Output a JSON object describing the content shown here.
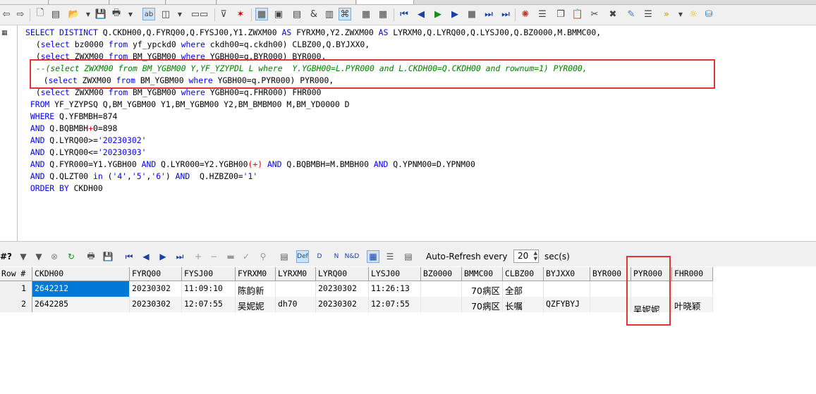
{
  "editor": {
    "lines": [
      [
        [
          "kw",
          "SELECT DISTINCT "
        ],
        [
          "t",
          "Q.CKDH00,Q.FYRQ00,Q.FYSJ00,Y1.ZWXM00 "
        ],
        [
          "kw",
          "AS "
        ],
        [
          "t",
          "FYRXM0,Y2.ZWXM00 "
        ],
        [
          "kw",
          "AS "
        ],
        [
          "t",
          "LYRXM0,Q.LYRQ00,Q.LYSJ00,Q.BZ0000,M.BMMC00,"
        ]
      ],
      [
        [
          "t",
          " ("
        ],
        [
          "kw",
          "select "
        ],
        [
          "t",
          "bz0000 "
        ],
        [
          "kw",
          "from "
        ],
        [
          "t",
          "yf_ypckd0 "
        ],
        [
          "kw",
          "where "
        ],
        [
          "t",
          "ckdh00=q.ckdh00) CLBZ00,Q.BYJXX0,"
        ]
      ],
      [
        [
          "t",
          " ("
        ],
        [
          "kw",
          "select "
        ],
        [
          "t",
          "ZWXM00 "
        ],
        [
          "kw",
          "from "
        ],
        [
          "t",
          "BM_YGBM00 "
        ],
        [
          "kw",
          "where "
        ],
        [
          "t",
          "YGBH00=q.BYR000) BYR000,"
        ]
      ],
      [
        [
          "cm",
          " --(select ZWXM00 from BM_YGBM00 Y,YF_YZYPDL L where  Y.YGBH00=L.PYR000 and L.CKDH00=Q.CKDH00 and rownum=1) PYR000,"
        ]
      ],
      [
        [
          "t",
          "  ("
        ],
        [
          "kw",
          "select "
        ],
        [
          "t",
          "ZWXM00 "
        ],
        [
          "kw",
          "from "
        ],
        [
          "t",
          "BM_YGBM00 "
        ],
        [
          "kw",
          "where "
        ],
        [
          "t",
          "YGBH00=q.PYR000) PYR000,"
        ]
      ],
      [
        [
          "t",
          " ("
        ],
        [
          "kw",
          "select "
        ],
        [
          "t",
          "ZWXM00 "
        ],
        [
          "kw",
          "from "
        ],
        [
          "t",
          "BM_YGBM00 "
        ],
        [
          "kw",
          "where "
        ],
        [
          "t",
          "YGBH00=q.FHR000) FHR000"
        ]
      ],
      [
        [
          "kw",
          " FROM "
        ],
        [
          "t",
          "YF_YZYPSQ Q,BM_YGBM00 Y1,BM_YGBM00 Y2,BM_BMBM00 M,BM_YD0000 D"
        ]
      ],
      [
        [
          "kw",
          " WHERE "
        ],
        [
          "t",
          "Q.YFBMBH=874"
        ]
      ],
      [
        [
          "kw",
          " AND "
        ],
        [
          "t",
          "Q.BQBMBH"
        ],
        [
          "op",
          "+"
        ],
        [
          "t",
          "0=898"
        ]
      ],
      [
        [
          "kw",
          " AND "
        ],
        [
          "t",
          "Q.LYRQ00>="
        ],
        [
          "str",
          "'20230302'"
        ]
      ],
      [
        [
          "kw",
          " AND "
        ],
        [
          "t",
          "Q.LYRQ00<="
        ],
        [
          "str",
          "'20230303'"
        ]
      ],
      [
        [
          "kw",
          " AND "
        ],
        [
          "t",
          "Q.FYR000=Y1.YGBH00 "
        ],
        [
          "kw",
          "AND "
        ],
        [
          "t",
          "Q.LYR000=Y2.YGBH00"
        ],
        [
          "op",
          "(+) "
        ],
        [
          "kw",
          "AND "
        ],
        [
          "t",
          "Q.BQBMBH=M.BMBH00 "
        ],
        [
          "kw",
          "AND "
        ],
        [
          "t",
          "Q.YPNM00=D.YPNM00"
        ]
      ],
      [
        [
          "kw",
          " AND "
        ],
        [
          "t",
          "Q.QLZT00 "
        ],
        [
          "kw",
          "in "
        ],
        [
          "t",
          "("
        ],
        [
          "str",
          "'4'"
        ],
        [
          "t",
          ","
        ],
        [
          "str",
          "'5'"
        ],
        [
          "t",
          ","
        ],
        [
          "str",
          "'6'"
        ],
        [
          "t",
          ") "
        ],
        [
          "kw",
          "AND  "
        ],
        [
          "t",
          "Q.HZBZ00="
        ],
        [
          "str",
          "'1'"
        ]
      ],
      [
        [
          "kw",
          " ORDER BY "
        ],
        [
          "t",
          "CKDH00"
        ]
      ]
    ]
  },
  "results_toolbar": {
    "hash_label": "#?",
    "auto_refresh_label": "Auto-Refresh every",
    "interval_value": "20",
    "unit_label": "sec(s)"
  },
  "grid": {
    "headers": [
      "Row #",
      "CKDH00",
      "FYRQ00",
      "FYSJ00",
      "FYRXM0",
      "LYRXM0",
      "LYRQ00",
      "LYSJ00",
      "BZ0000",
      "BMMC00",
      "CLBZ00",
      "BYJXX0",
      "BYR000",
      "PYR000",
      "FHR000"
    ],
    "rows": [
      [
        "1",
        "2642212",
        "20230302",
        "11:09:10",
        "陈韵新",
        "",
        "20230302",
        "11:26:13",
        "",
        "70病区",
        "全部",
        "",
        "",
        "",
        ""
      ],
      [
        "2",
        "2642285",
        "20230302",
        "12:07:55",
        "吴妮妮",
        "dh70",
        "20230302",
        "12:07:55",
        "",
        "70病区",
        "长嘱",
        "QZFYBYJ",
        "",
        "吴妮妮",
        "叶晓颖"
      ]
    ]
  },
  "icons": {
    "main_toolbar": [
      "back-arrow-icon",
      "forward-arrow-icon",
      "new-icon",
      "open-icon",
      "open-dropdown-icon",
      "save-icon",
      "print-icon",
      "find-icon",
      "layout-icon",
      "sql-window-icon",
      "filter-icon",
      "clear-filter-icon",
      "explain-icon",
      "commit-icon",
      "rollback-icon",
      "first-icon",
      "prev-icon",
      "run-icon",
      "next-icon",
      "stop-icon",
      "last-icon",
      "end-icon",
      "debug-icon",
      "report-icon",
      "copy-icon",
      "paste-icon",
      "cut-icon",
      "delete-icon",
      "tools-icon",
      "forward-icon",
      "sound-icon",
      "lightbulb-icon",
      "db-icon"
    ],
    "results_toolbar": [
      "filter-icon",
      "sort-icon",
      "cancel-icon",
      "refresh-icon",
      "print-icon",
      "save-icon",
      "first-record-icon",
      "prev-record-icon",
      "next-record-icon",
      "last-record-icon",
      "add-record-icon",
      "delete-record-icon",
      "post-icon",
      "cancel-edit-icon",
      "clear-icon",
      "def-icon",
      "d-icon",
      "n-icon",
      "nd-icon",
      "grid-view-icon",
      "form-view-icon"
    ]
  }
}
